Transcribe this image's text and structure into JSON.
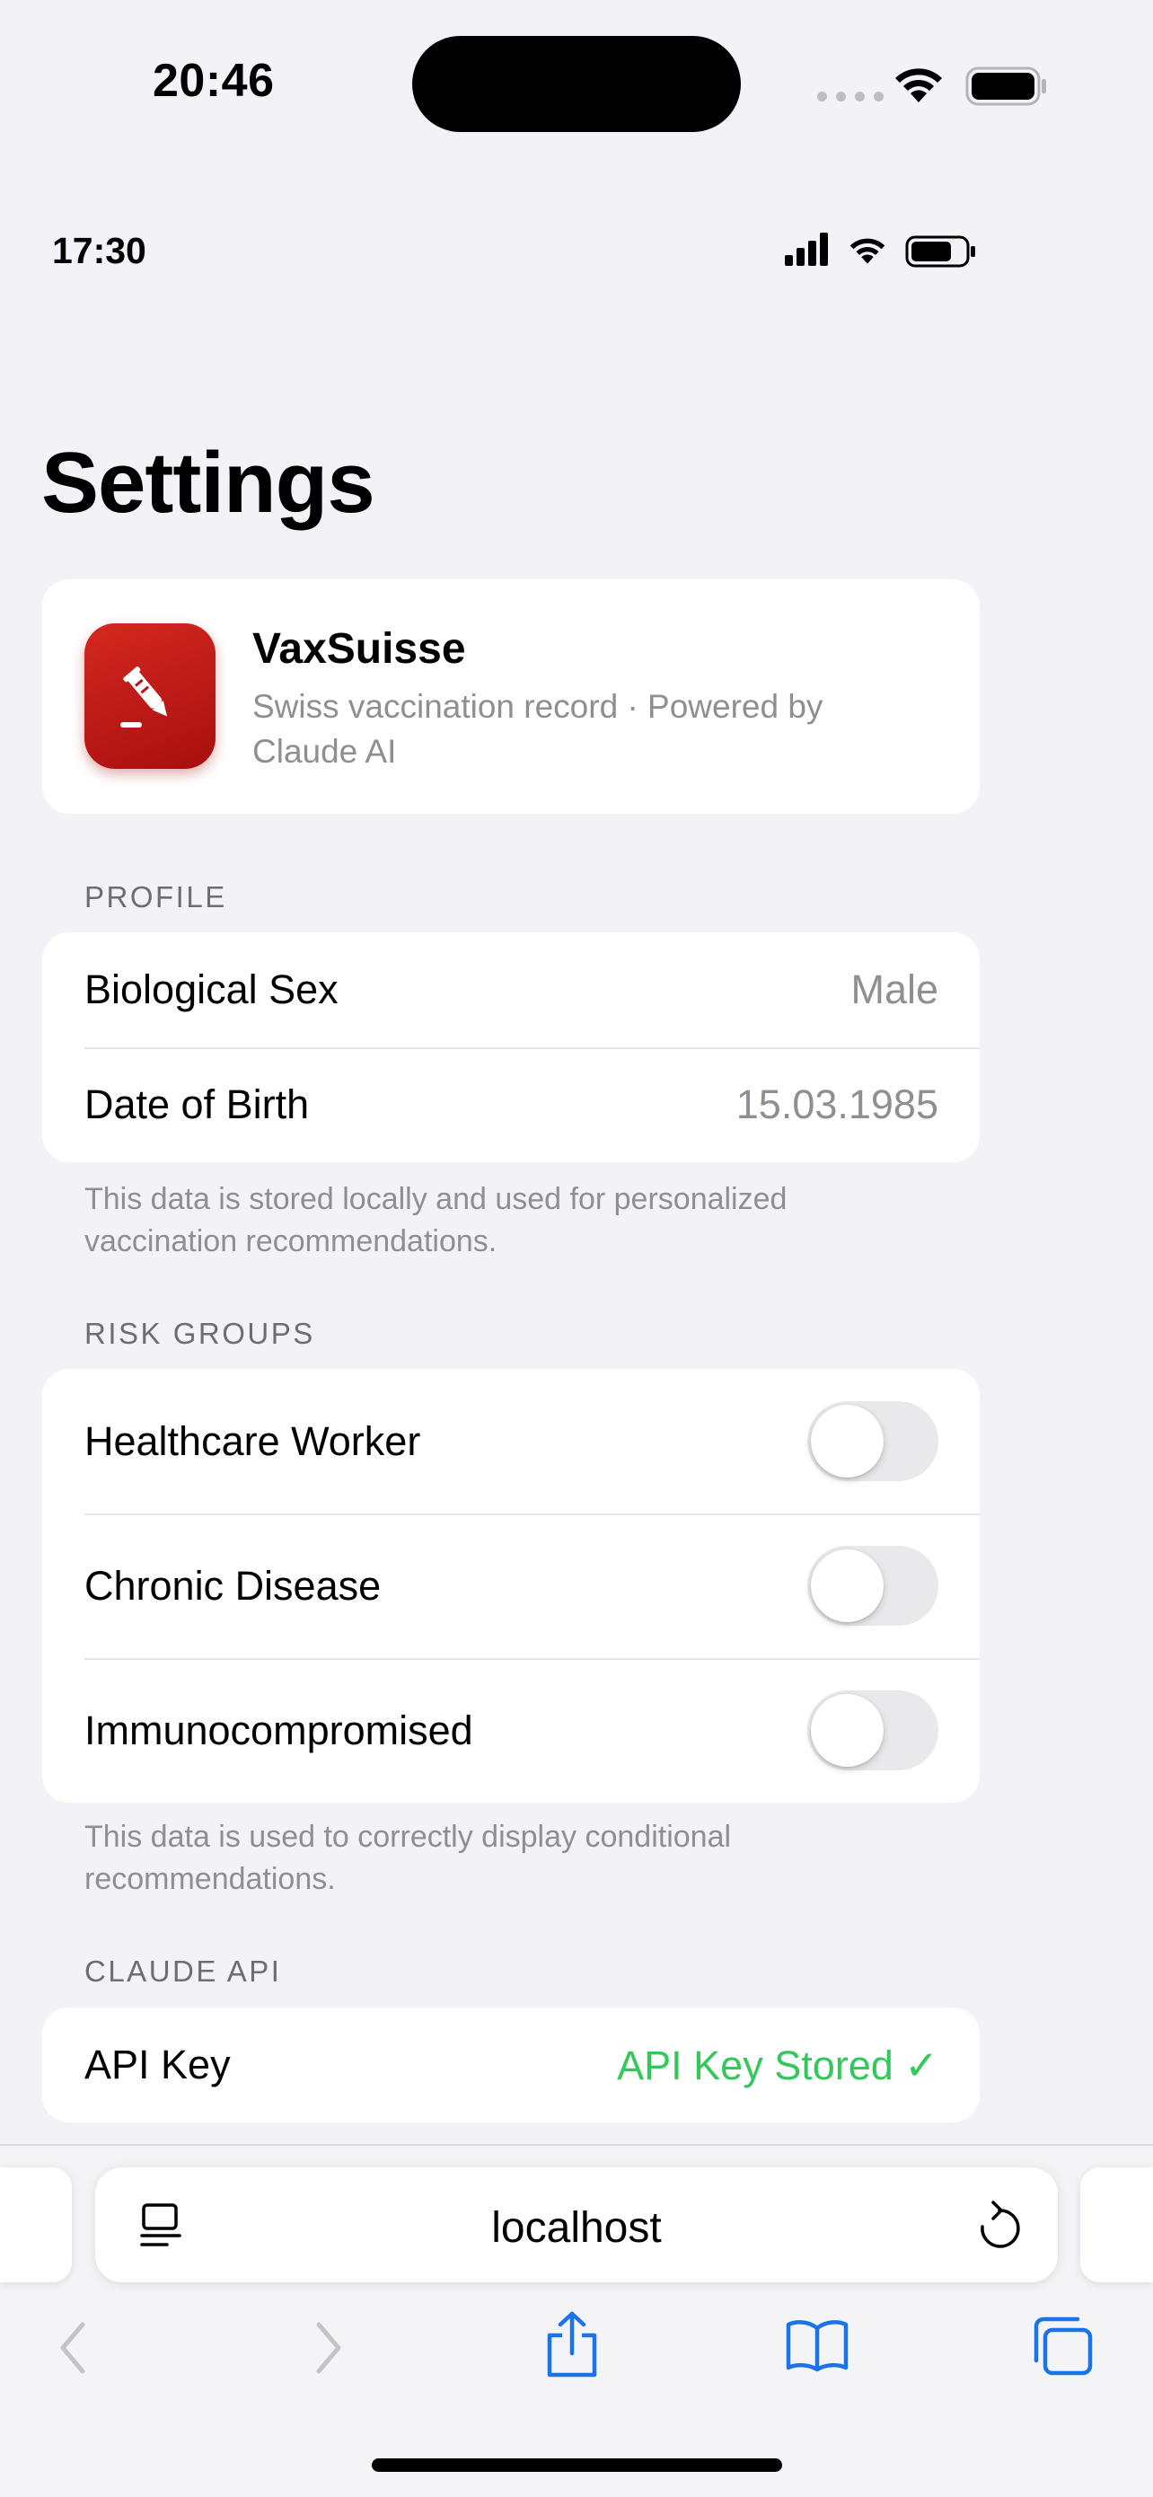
{
  "device": {
    "time": "20:46"
  },
  "app_status": {
    "time": "17:30"
  },
  "page": {
    "title": "Settings"
  },
  "app_card": {
    "name": "VaxSuisse",
    "subtitle": "Swiss vaccination record · Powered by Claude AI"
  },
  "profile": {
    "header": "PROFILE",
    "rows": [
      {
        "label": "Biological Sex",
        "value": "Male"
      },
      {
        "label": "Date of Birth",
        "value": "15.03.1985"
      }
    ],
    "footnote": "This data is stored locally and used for personalized vaccination recommendations."
  },
  "risk_groups": {
    "header": "RISK GROUPS",
    "rows": [
      {
        "label": "Healthcare Worker",
        "enabled": false
      },
      {
        "label": "Chronic Disease",
        "enabled": false
      },
      {
        "label": "Immunocompromised",
        "enabled": false
      }
    ],
    "footnote": "This data is used to correctly display conditional recommendations."
  },
  "claude_api": {
    "header": "CLAUDE API",
    "rows": [
      {
        "label": "API Key",
        "value": "API Key Stored ✓"
      }
    ]
  },
  "browser": {
    "url": "localhost",
    "icons": [
      "reader-icon",
      "reload-icon",
      "back-icon",
      "forward-icon",
      "share-icon",
      "bookmarks-icon",
      "tabs-icon"
    ]
  },
  "colors": {
    "accent_green": "#34c759",
    "app_icon_red": "#c81e1e",
    "background": "#f2f2f7"
  }
}
